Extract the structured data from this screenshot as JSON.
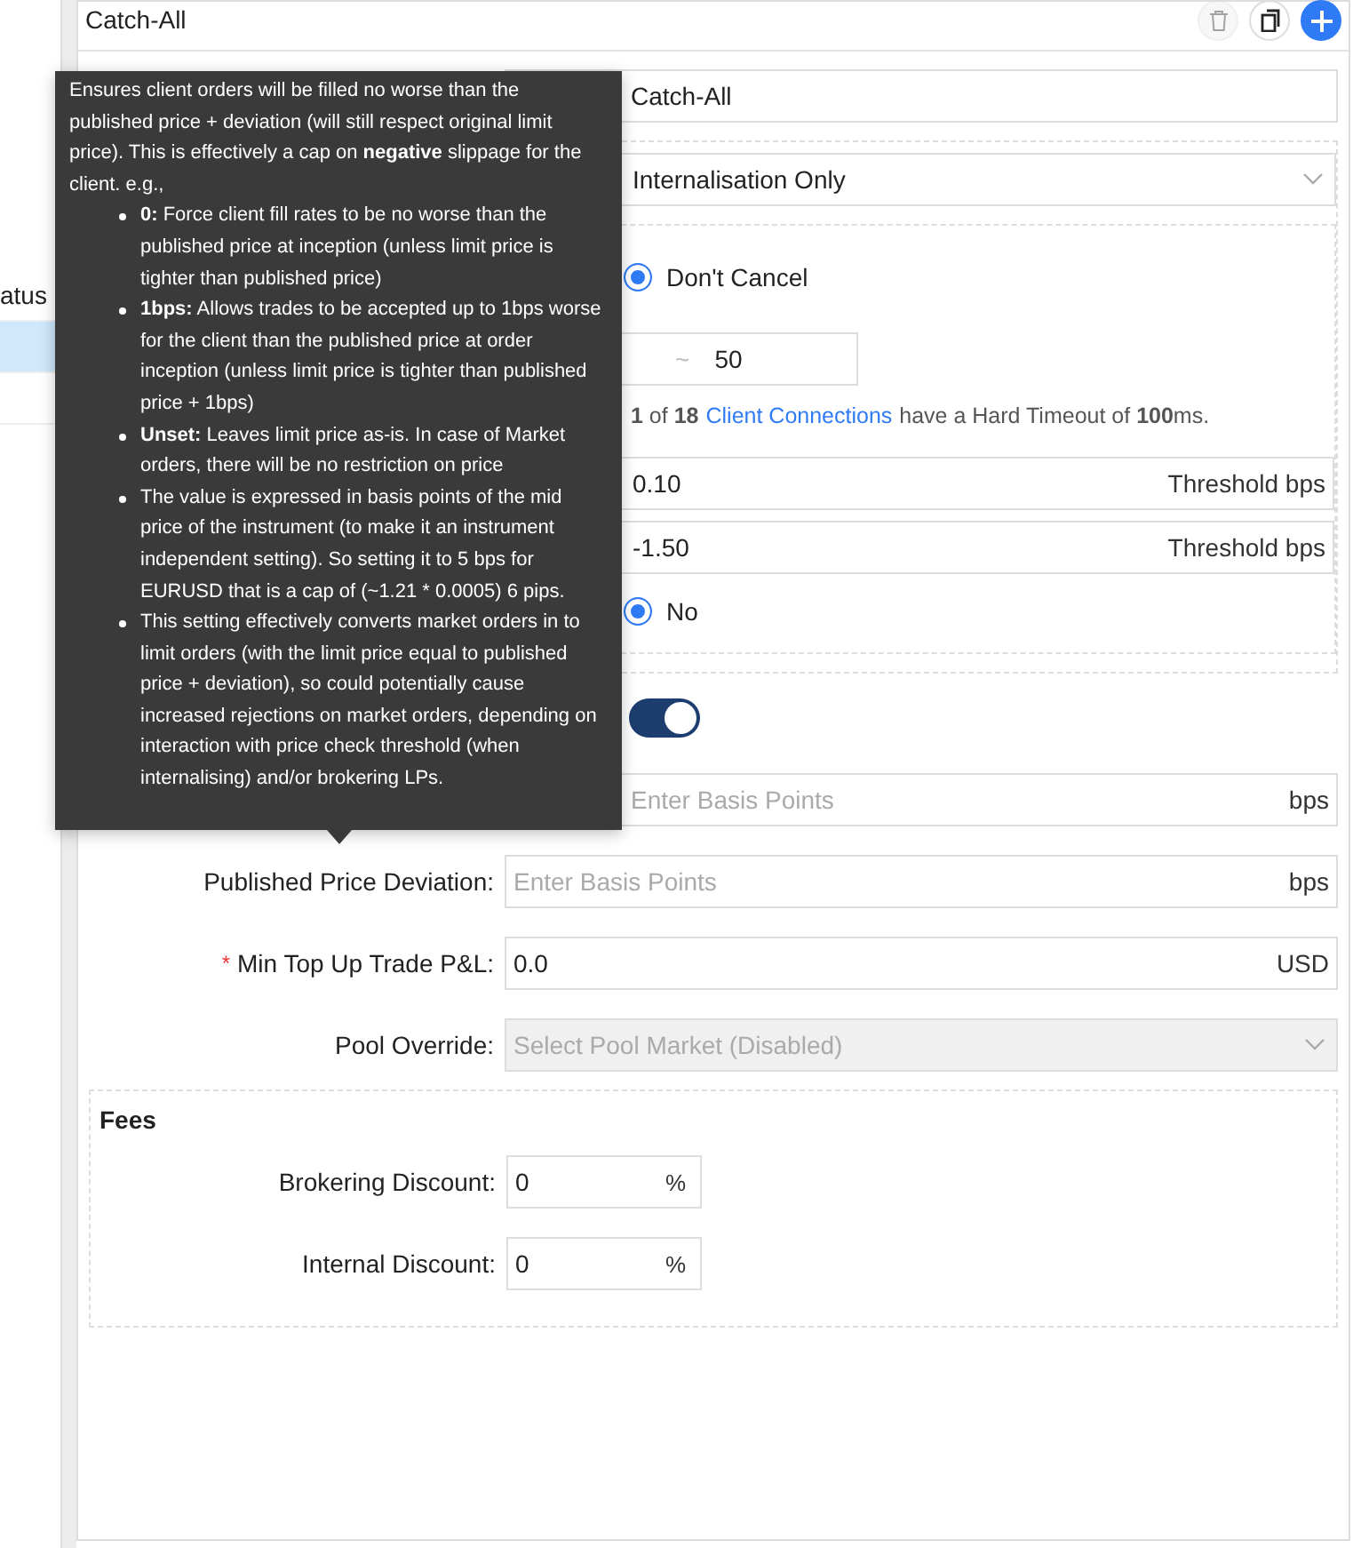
{
  "sidebar": {
    "column_header": "atus",
    "rows": [
      {
        "selected": true
      },
      {
        "selected": false
      }
    ]
  },
  "panel": {
    "title": "Catch-All",
    "actions": [
      {
        "kind": "delete",
        "disabled": true
      },
      {
        "kind": "copy",
        "disabled": false
      },
      {
        "kind": "add",
        "disabled": false
      }
    ]
  },
  "form": {
    "fields": [
      {
        "kind": "text",
        "value": "Catch-All"
      },
      {
        "kind": "group",
        "fields": [
          {
            "kind": "select",
            "value": "Internalisation Only"
          },
          {
            "kind": "group",
            "fields": [
              {
                "kind": "radio",
                "options": [
                  {
                    "label": "Don't Cancel",
                    "selected": true
                  }
                ]
              },
              {
                "kind": "range",
                "separator": "~",
                "value": "50"
              },
              {
                "kind": "note",
                "before": "**1** of **18**",
                "link": "Client Connections",
                "after": "have a Hard Timeout of **100**ms."
              },
              {
                "kind": "text",
                "value": "0.10",
                "suffix": "Threshold bps"
              },
              {
                "kind": "text",
                "value": "-1.50",
                "suffix": "Threshold bps"
              },
              {
                "kind": "radio",
                "options": [
                  {
                    "label": "No",
                    "selected": true
                  }
                ]
              }
            ]
          }
        ]
      },
      {
        "kind": "toggle",
        "on": true
      },
      {
        "kind": "text",
        "placeholder": "Enter Basis Points",
        "suffix": "bps"
      },
      {
        "kind": "text",
        "label": "Published Price Deviation:",
        "placeholder": "Enter Basis Points",
        "suffix": "bps"
      },
      {
        "kind": "text",
        "label": "Min Top Up Trade P&L:",
        "required_mark": "*",
        "value": "0.0",
        "suffix": "USD"
      },
      {
        "kind": "select",
        "label": "Pool Override:",
        "placeholder": "Select Pool Market (Disabled)",
        "disabled": true
      }
    ]
  },
  "fees": {
    "title": "Fees",
    "fields": [
      {
        "label": "Brokering Discount:",
        "value": "0",
        "suffix": "%"
      },
      {
        "label": "Internal Discount:",
        "value": "0",
        "suffix": "%"
      }
    ]
  },
  "tooltip": {
    "intro": "Ensures client orders will be filled no worse than the published price + deviation (will still respect original limit price). This is effectively a cap on **negative** slippage for the client. e.g.,",
    "bullets": [
      "**0:** Force client fill rates to be no worse than the published price at inception (unless limit price is tighter than published price)",
      "**1bps:** Allows trades to be accepted up to 1bps worse for the client than the published price at order inception (unless limit price is tighter than published price + 1bps)",
      "**Unset:** Leaves limit price as-is. In case of Market orders, there will be no restriction on price",
      "The value is expressed in basis points of the mid price of the instrument (to make it an instrument independent setting). So setting it to 5 bps for EURUSD that is a cap of (~1.21 * 0.0005) 6 pips.",
      "This setting effectively converts market orders in to limit orders (with the limit price equal to published price + deviation), so could potentially cause increased rejections on market orders, depending on interaction with price check threshold (when internalising) and/or brokering LPs."
    ]
  }
}
